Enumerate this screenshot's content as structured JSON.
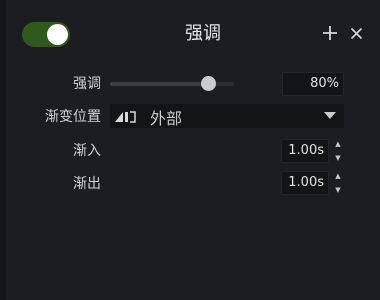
{
  "header": {
    "title": "强调",
    "toggle_state": "on"
  },
  "rows": {
    "emphasis": {
      "label": "强调",
      "value": 80,
      "value_text": "80%"
    },
    "fade_position": {
      "label": "渐变位置",
      "value": "外部"
    },
    "fade_in": {
      "label": "渐入",
      "value": "1.00s"
    },
    "fade_out": {
      "label": "渐出",
      "value": "1.00s"
    }
  },
  "colors": {
    "toggle_on": "#2f5a1d",
    "panel_bg": "#1b1d20",
    "field_bg": "#131416"
  },
  "icons": {
    "add": "plus-icon",
    "close": "close-icon",
    "fade": "fade-gradient-icon",
    "dropdown": "caret-down-icon",
    "stepper": "up-down-arrows"
  }
}
